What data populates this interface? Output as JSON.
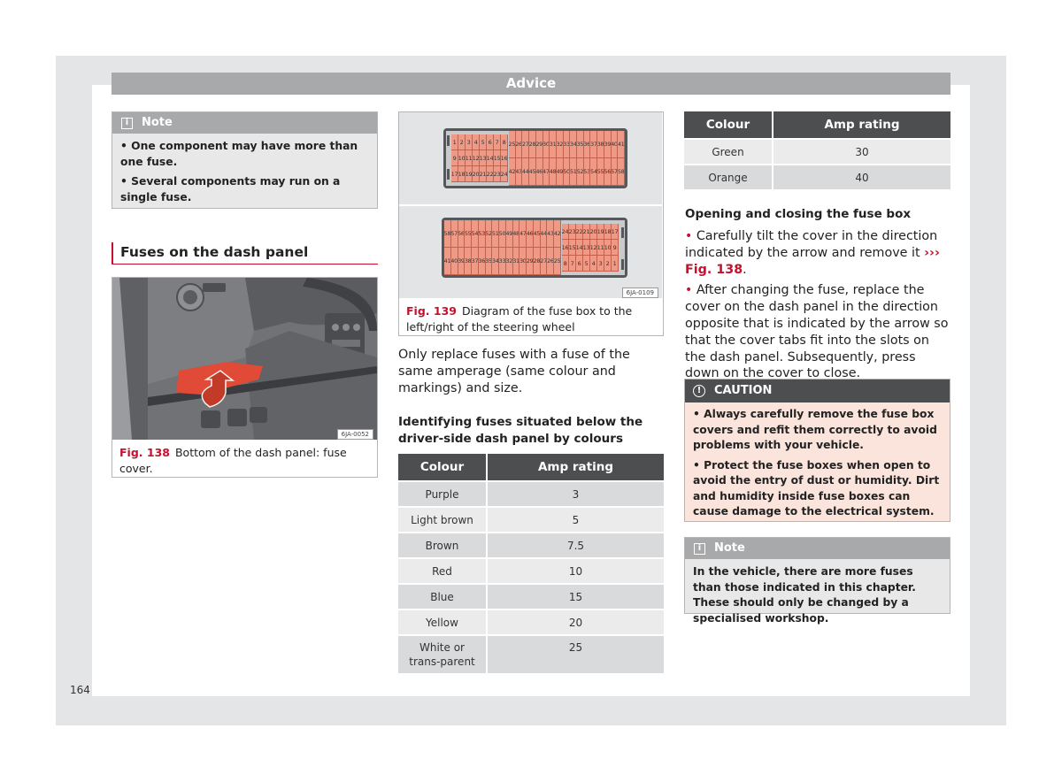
{
  "header": {
    "title": "Advice"
  },
  "page_number": "164",
  "note_top": {
    "title": "Note",
    "icon": "info-icon",
    "items": [
      "• One component may have more than one fuse.",
      "• Several components may run on a single fuse."
    ]
  },
  "section": {
    "title": "Fuses on the dash panel"
  },
  "fig138": {
    "code": "6JA-0052",
    "number": "Fig. 138",
    "caption": "Bottom of the dash panel: fuse cover."
  },
  "fig139": {
    "code": "6JA-0109",
    "number": "Fig. 139",
    "caption": "Diagram of the fuse box to the left/right of the steering wheel",
    "top_box": {
      "small_block": [
        [
          "1",
          "2",
          "3",
          "4",
          "5",
          "6",
          "7",
          "8"
        ],
        [
          "9",
          "10",
          "11",
          "12",
          "13",
          "14",
          "15",
          "16"
        ],
        [
          "17",
          "18",
          "19",
          "20",
          "21",
          "22",
          "23",
          "24"
        ]
      ],
      "large_block": [
        [
          "25",
          "26",
          "27",
          "28",
          "29",
          "30",
          "31",
          "32",
          "33",
          "34",
          "35",
          "36",
          "37",
          "38",
          "39",
          "40",
          "41"
        ],
        [
          "42",
          "43",
          "44",
          "45",
          "46",
          "47",
          "48",
          "49",
          "50",
          "51",
          "52",
          "53",
          "54",
          "55",
          "56",
          "57",
          "58"
        ]
      ]
    },
    "bottom_box": {
      "large_block": [
        [
          "58",
          "57",
          "56",
          "55",
          "54",
          "53",
          "52",
          "51",
          "50",
          "49",
          "48",
          "47",
          "46",
          "45",
          "44",
          "43",
          "42"
        ],
        [
          "41",
          "40",
          "39",
          "38",
          "37",
          "36",
          "35",
          "34",
          "33",
          "32",
          "31",
          "30",
          "29",
          "28",
          "27",
          "26",
          "25"
        ]
      ],
      "small_block": [
        [
          "24",
          "23",
          "22",
          "21",
          "20",
          "19",
          "18",
          "17"
        ],
        [
          "16",
          "15",
          "14",
          "13",
          "12",
          "11",
          "10",
          "9"
        ],
        [
          "8",
          "7",
          "6",
          "5",
          "4",
          "3",
          "2",
          "1"
        ]
      ]
    }
  },
  "middle": {
    "paragraph": "Only replace fuses with a fuse of the same amperage (same colour and markings) and size.",
    "subheading": "Identifying fuses situated below the driver-side dash panel by colours"
  },
  "table_main": {
    "headers": [
      "Colour",
      "Amp rating"
    ],
    "rows": [
      [
        "Purple",
        "3"
      ],
      [
        "Light brown",
        "5"
      ],
      [
        "Brown",
        "7.5"
      ],
      [
        "Red",
        "10"
      ],
      [
        "Blue",
        "15"
      ],
      [
        "Yellow",
        "20"
      ],
      [
        "White or trans-parent",
        "25"
      ]
    ]
  },
  "table_cont": {
    "headers": [
      "Colour",
      "Amp rating"
    ],
    "rows": [
      [
        "Green",
        "30"
      ],
      [
        "Orange",
        "40"
      ]
    ]
  },
  "opening": {
    "heading": "Opening and closing the fuse box",
    "item1_text": "Carefully tilt the cover in the direction indicated by the arrow and remove it ",
    "item1_link": "››› Fig. 138",
    "item2_text": "After changing the fuse, replace the cover on the dash panel in the direction opposite that is indicated by the arrow so that the cover tabs fit into the slots on the dash panel. Subsequently, press down on the cover to close."
  },
  "caution": {
    "title": "CAUTION",
    "icon": "exclamation-circle-icon",
    "items": [
      "• Always carefully remove the fuse box covers and refit them correctly to avoid problems with your vehicle.",
      "• Protect the fuse boxes when open to avoid the entry of dust or humidity. Dirt and humidity inside fuse boxes can cause damage to the electrical system."
    ]
  },
  "note_bottom": {
    "title": "Note",
    "icon": "info-icon",
    "text": "In the vehicle, there are more fuses than those indicated in this chapter. These should only be changed by a specialised workshop."
  },
  "colors": {
    "accent_red": "#c8102e",
    "header_gray": "#a8a9ab",
    "table_header": "#4d4e50",
    "caution_bg": "#fbe4dc",
    "fuse_orange": "#ef9a86"
  }
}
